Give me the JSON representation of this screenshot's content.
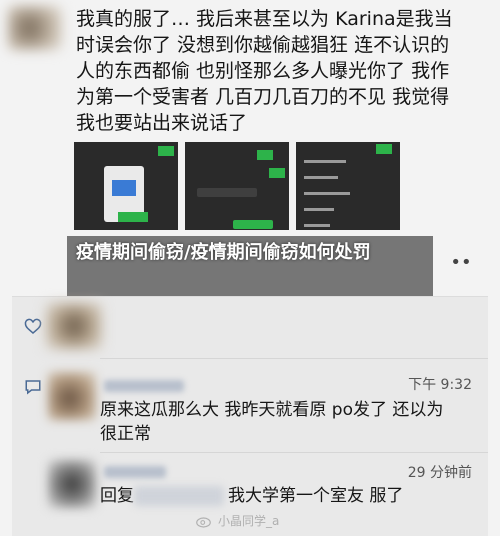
{
  "post": {
    "lines": [
      "我真的服了… 我后来甚至以为 Karina是我当",
      "时误会你了 没想到你越偷越猖狂 连不认识的",
      "人的东西都偷 也别怪那么多人曝光你了 我作",
      "为第一个受害者 几百刀几百刀的不见 我觉得",
      "我也要站出来说话了"
    ]
  },
  "thumbnails": [
    {
      "label": "Screenshot 1"
    },
    {
      "label": "Screenshot 2"
    },
    {
      "label": "Screenshot 3"
    }
  ],
  "overlay": {
    "title": "疫情期间偷窃/疫情期间偷窃如何处罚"
  },
  "more_label": "••",
  "comments": [
    {
      "time": "下午 9:32",
      "lines": [
        "原来这瓜那么大 我昨天就看原 po发了 还以为",
        "很正常"
      ]
    },
    {
      "time": "29 分钟前",
      "prefix": "回复",
      "suffix": "我大学第一个室友 服了"
    }
  ],
  "watermark": {
    "text": "小晶同学_a"
  },
  "colors": {
    "accent_green": "#2db34a",
    "panel_bg": "#e9e9e9",
    "overlay_bg": "#5a5a5a"
  }
}
